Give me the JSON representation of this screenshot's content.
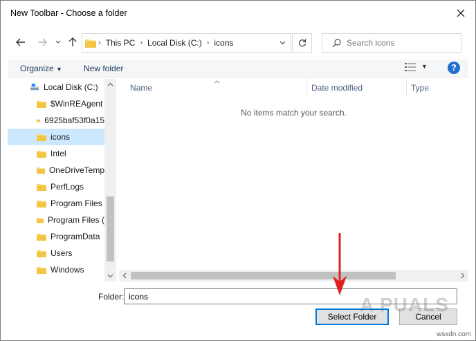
{
  "window": {
    "title": "New Toolbar - Choose a folder"
  },
  "address": {
    "segments": [
      "This PC",
      "Local Disk (C:)",
      "icons"
    ]
  },
  "search": {
    "placeholder": "Search icons"
  },
  "commands": {
    "organize": "Organize",
    "new_folder": "New folder"
  },
  "tree": {
    "items": [
      {
        "label": "Local Disk (C:)",
        "icon": "drive-icon",
        "selected": false
      },
      {
        "label": "$WinREAgent",
        "icon": "folder-icon",
        "selected": false
      },
      {
        "label": "6925baf53f0a15",
        "icon": "folder-icon",
        "selected": false
      },
      {
        "label": "icons",
        "icon": "folder-icon",
        "selected": true
      },
      {
        "label": "Intel",
        "icon": "folder-icon",
        "selected": false
      },
      {
        "label": "OneDriveTemp",
        "icon": "folder-icon",
        "selected": false
      },
      {
        "label": "PerfLogs",
        "icon": "folder-icon",
        "selected": false
      },
      {
        "label": "Program Files",
        "icon": "folder-icon",
        "selected": false
      },
      {
        "label": "Program Files (",
        "icon": "folder-icon",
        "selected": false
      },
      {
        "label": "ProgramData",
        "icon": "folder-icon",
        "selected": false
      },
      {
        "label": "Users",
        "icon": "folder-icon",
        "selected": false
      },
      {
        "label": "Windows",
        "icon": "folder-icon",
        "selected": false
      }
    ]
  },
  "list": {
    "columns": [
      "Name",
      "Date modified",
      "Type"
    ],
    "empty_message": "No items match your search."
  },
  "footer": {
    "folder_label": "Folder:",
    "folder_value": "icons",
    "select_label": "Select Folder",
    "cancel_label": "Cancel"
  },
  "overlay": {
    "watermark": "A PUALS",
    "credit": "wsxdn.com"
  },
  "colors": {
    "accent": "#0078d7",
    "selection": "#cce8ff",
    "folder": "#f8d775",
    "arrow": "#e02020"
  }
}
